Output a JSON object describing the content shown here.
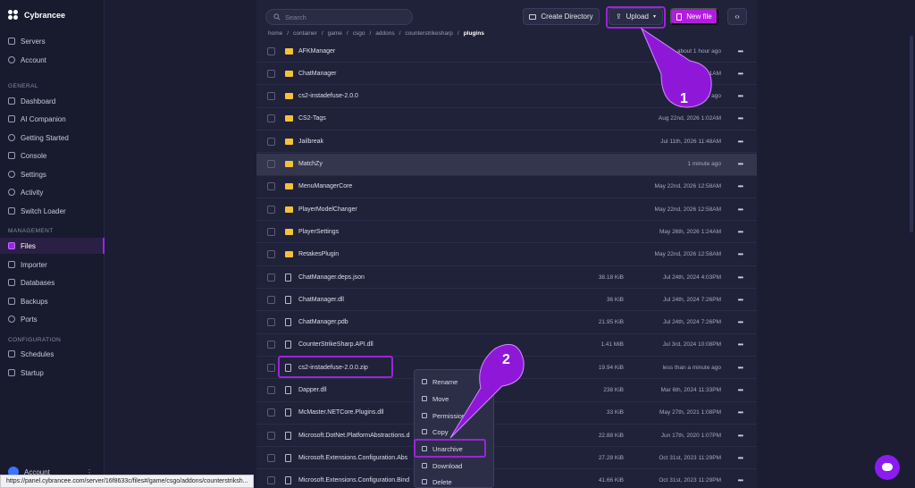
{
  "brand": {
    "name": "Cybrancee"
  },
  "nav": {
    "top": [
      {
        "label": "Servers"
      },
      {
        "label": "Account"
      }
    ],
    "section_general": "GENERAL",
    "general": [
      {
        "label": "Dashboard"
      },
      {
        "label": "AI Companion"
      },
      {
        "label": "Getting Started"
      },
      {
        "label": "Console"
      },
      {
        "label": "Settings"
      },
      {
        "label": "Activity"
      },
      {
        "label": "Switch Loader"
      }
    ],
    "section_management": "MANAGEMENT",
    "management": [
      {
        "label": "Files",
        "active": true
      },
      {
        "label": "Importer"
      },
      {
        "label": "Databases"
      },
      {
        "label": "Backups"
      },
      {
        "label": "Ports"
      }
    ],
    "section_configuration": "CONFIGURATION",
    "configuration": [
      {
        "label": "Schedules"
      },
      {
        "label": "Startup"
      }
    ],
    "account_label": "Account"
  },
  "toolbar": {
    "search_placeholder": "Search",
    "create_directory": "Create Directory",
    "upload": "Upload",
    "new_file": "New file"
  },
  "breadcrumb": [
    "home",
    "/",
    "container",
    "/",
    "game",
    "/",
    "csgo",
    "/",
    "addons",
    "/",
    "counterstrikesharp",
    "/"
  ],
  "breadcrumb_current": "plugins",
  "files": [
    {
      "name": "AFKManager",
      "type": "folder",
      "size": "",
      "date": "about 1 hour ago"
    },
    {
      "name": "ChatManager",
      "type": "folder",
      "size": "",
      "date": "2026 1:31AM"
    },
    {
      "name": "cs2-instadefuse-2.0.0",
      "type": "folder",
      "size": "",
      "date": "e ago"
    },
    {
      "name": "CS2-Tags",
      "type": "folder",
      "size": "",
      "date": "Aug 22nd, 2026 1:02AM"
    },
    {
      "name": "Jailbreak",
      "type": "folder",
      "size": "",
      "date": "Jul 11th, 2026 11:48AM"
    },
    {
      "name": "MatchZy",
      "type": "folder",
      "size": "",
      "date": "1 minute ago"
    },
    {
      "name": "MenuManagerCore",
      "type": "folder",
      "size": "",
      "date": "May 22nd, 2026 12:58AM"
    },
    {
      "name": "PlayerModelChanger",
      "type": "folder",
      "size": "",
      "date": "May 22nd, 2026 12:58AM"
    },
    {
      "name": "PlayerSettings",
      "type": "folder",
      "size": "",
      "date": "May 26th, 2026 1:24AM"
    },
    {
      "name": "RetakesPlugin",
      "type": "folder",
      "size": "",
      "date": "May 22nd, 2026 12:58AM"
    },
    {
      "name": "ChatManager.deps.json",
      "type": "file",
      "size": "38.18 KiB",
      "date": "Jul 24th, 2024 4:03PM"
    },
    {
      "name": "ChatManager.dll",
      "type": "file",
      "size": "36 KiB",
      "date": "Jul 24th, 2024 7:26PM"
    },
    {
      "name": "ChatManager.pdb",
      "type": "file",
      "size": "21.95 KiB",
      "date": "Jul 24th, 2024 7:26PM"
    },
    {
      "name": "CounterStrikeSharp.API.dll",
      "type": "file",
      "size": "1.41 MiB",
      "date": "Jul 3rd, 2024 10:08PM"
    },
    {
      "name": "cs2-instadefuse-2.0.0.zip",
      "type": "file",
      "size": "19.94 KiB",
      "date": "less than a minute ago"
    },
    {
      "name": "Dapper.dll",
      "type": "file",
      "size": "238 KiB",
      "date": "Mar 6th, 2024 11:33PM"
    },
    {
      "name": "McMaster.NETCore.Plugins.dll",
      "type": "file",
      "size": "33 KiB",
      "date": "May 27th, 2021 1:08PM"
    },
    {
      "name": "Microsoft.DotNet.PlatformAbstractions.d",
      "type": "file",
      "size": "22.88 KiB",
      "date": "Jun 17th, 2020 1:07PM"
    },
    {
      "name": "Microsoft.Extensions.Configuration.Abs",
      "type": "file",
      "size": "27.28 KiB",
      "date": "Oct 31st, 2023 11:29PM"
    },
    {
      "name": "Microsoft.Extensions.Configuration.Bind",
      "type": "file",
      "size": "41.66 KiB",
      "date": "Oct 31st, 2023 11:29PM"
    }
  ],
  "context_menu": [
    {
      "label": "Rename",
      "icon": "rename-icon"
    },
    {
      "label": "Move",
      "icon": "move-icon"
    },
    {
      "label": "Permissions",
      "icon": "key-icon"
    },
    {
      "label": "Copy",
      "icon": "copy-icon"
    },
    {
      "label": "Unarchive",
      "icon": "unarchive-icon"
    },
    {
      "label": "Download",
      "icon": "download-icon"
    },
    {
      "label": "Delete",
      "icon": "trash-icon"
    }
  ],
  "annotations": {
    "step1": "1",
    "step2": "2"
  },
  "status_url": "https://panel.cybrancee.com/server/16f8633c/files#/game/csgo/addons/counterstriksh...",
  "colors": {
    "accent": "#b21ce0",
    "highlight": "#9b24d6",
    "folder": "#f4c23a"
  }
}
